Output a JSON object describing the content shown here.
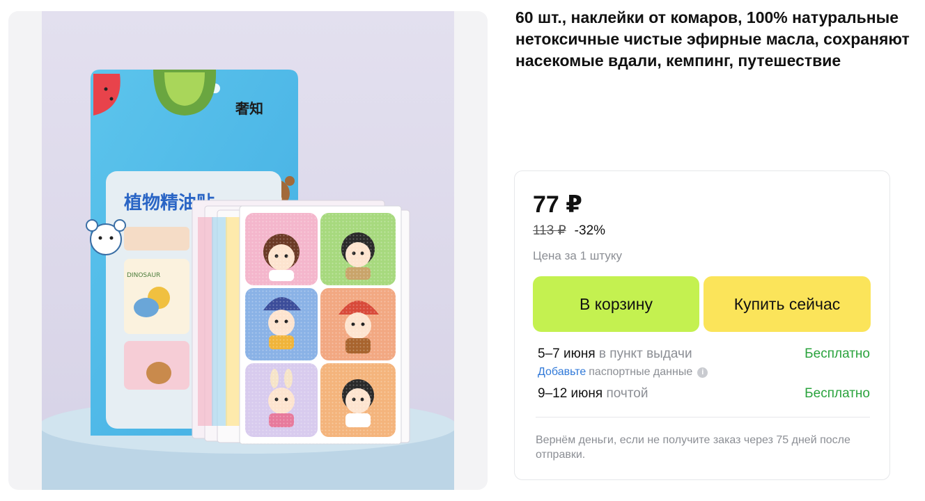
{
  "product": {
    "title": "60 шт., наклейки от комаров, 100% натуральные нетоксичные чистые эфирные масла, сохраняют насекомые вдали, кемпинг, путешествие"
  },
  "image": {
    "brand_text": "奢知",
    "pack_text": "植物精油贴",
    "sticker_text": "DINOSAUR"
  },
  "price": {
    "current": "77 ₽",
    "old": "113 ₽",
    "discount": "-32%",
    "unit_note": "Цена за 1 штуку"
  },
  "buttons": {
    "cart": "В корзину",
    "buy_now": "Купить сейчас"
  },
  "delivery": {
    "pickup_dates": "5–7 июня",
    "pickup_method": "в пункт выдачи",
    "pickup_cost": "Бесплатно",
    "passport_link": "Добавьте",
    "passport_text": "паспортные данные",
    "post_dates": "9–12 июня",
    "post_method": "почтой",
    "post_cost": "Бесплатно"
  },
  "refund_note": "Вернём деньги, если не получите заказ через 75 дней после отправки.",
  "icons": {
    "info": "info-icon"
  },
  "colors": {
    "cart_button": "#c4f150",
    "buy_button": "#fbe45a",
    "free_text": "#2aa33d",
    "link": "#2f78d8"
  }
}
